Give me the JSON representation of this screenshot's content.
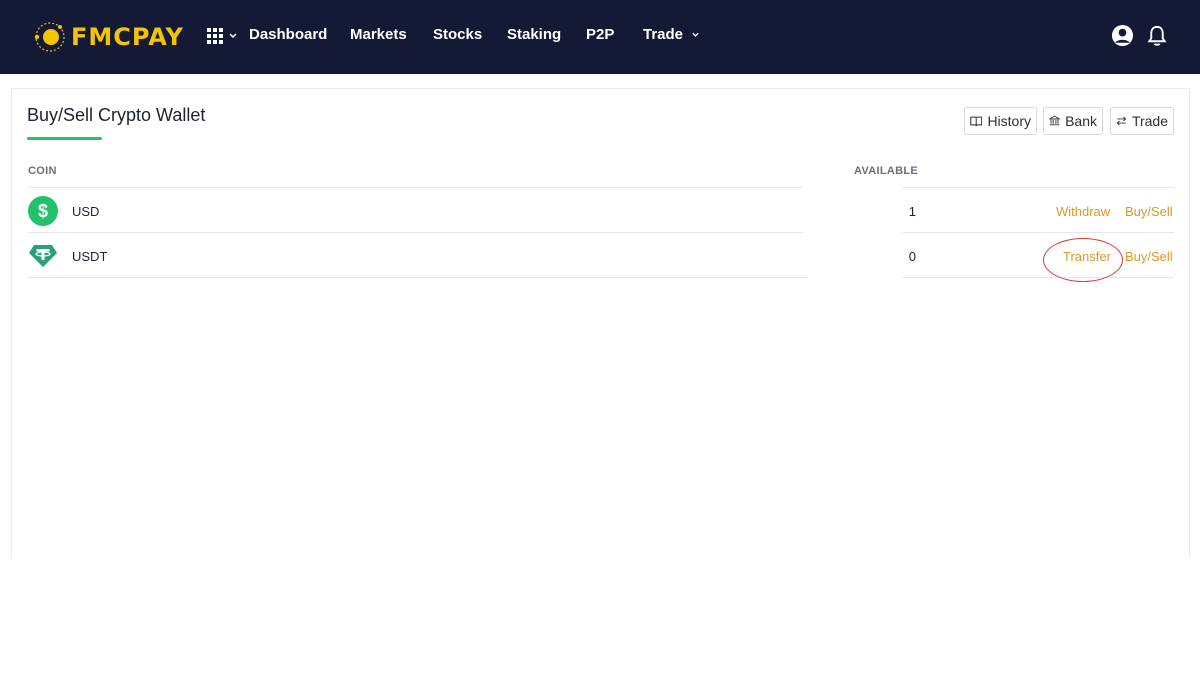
{
  "nav": {
    "brand": "FMCPAY",
    "items": [
      {
        "label": "Dashboard"
      },
      {
        "label": "Markets"
      },
      {
        "label": "Stocks"
      },
      {
        "label": "Staking"
      },
      {
        "label": "P2P"
      },
      {
        "label": "Trade"
      }
    ],
    "icons": [
      "grid-menu-icon",
      "user-icon",
      "bell-icon"
    ]
  },
  "wallet": {
    "title": "Buy/Sell Crypto Wallet",
    "buttons": {
      "history": "History",
      "bank": "Bank",
      "trade": "Trade"
    },
    "columns": {
      "coin": "COIN",
      "available": "AVAILABLE"
    },
    "rows": [
      {
        "name": "USD",
        "available": "1",
        "action1": "Withdraw",
        "action2": "Buy/Sell",
        "icon": "dollar-coin-icon"
      },
      {
        "name": "USDT",
        "available": "0",
        "action1": "Transfer",
        "action2": "Buy/Sell",
        "icon": "tether-coin-icon"
      }
    ]
  },
  "colors": {
    "navbar": "#141a35",
    "brand": "#f5c400",
    "accent_green": "#21c269",
    "action_link": "#d79a2b",
    "annotation": "#d63b3b"
  }
}
